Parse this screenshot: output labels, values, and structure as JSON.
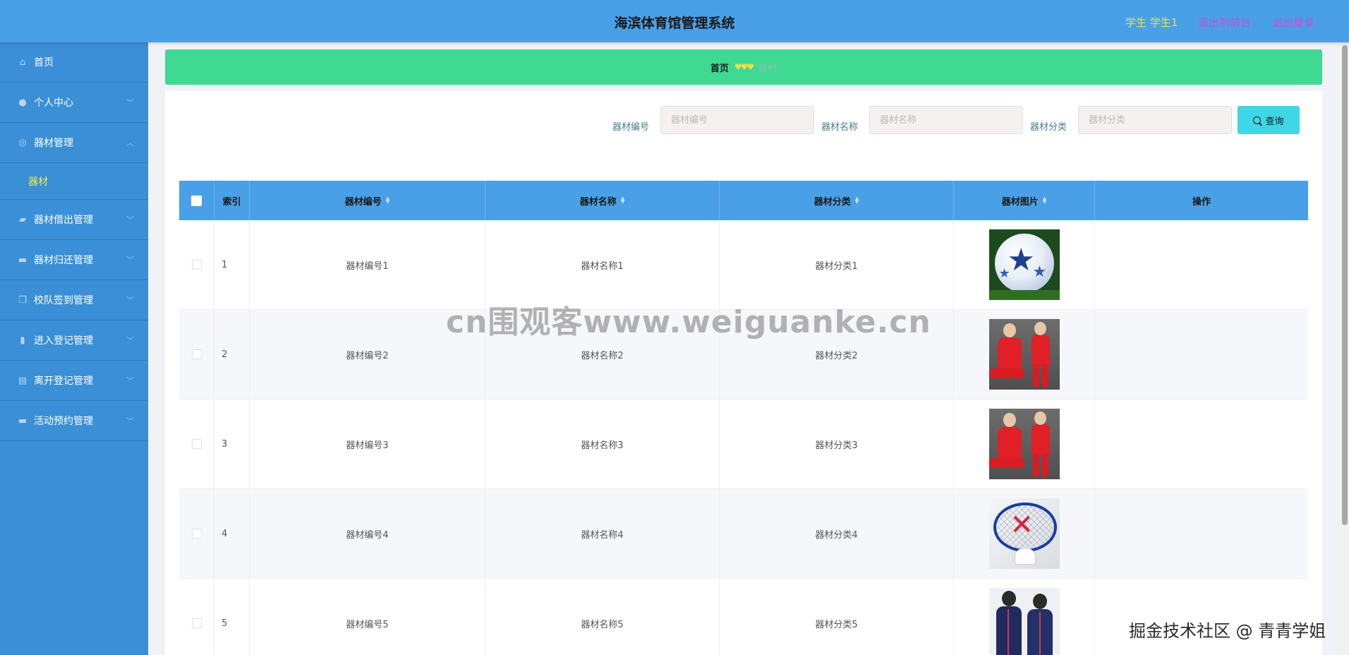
{
  "header": {
    "title": "海滨体育馆管理系统",
    "user": "学生 学生1",
    "to_frontend": "退出到前台",
    "logout": "退出登录"
  },
  "sidebar": {
    "items": [
      {
        "label": "首页",
        "icon": "home-icon"
      },
      {
        "label": "个人中心",
        "icon": "user-icon"
      },
      {
        "label": "器材管理",
        "icon": "compass-icon"
      },
      {
        "label": "器材",
        "icon": ""
      },
      {
        "label": "器材借出管理",
        "icon": "thumbs-up-icon"
      },
      {
        "label": "器材归还管理",
        "icon": "monitor-icon"
      },
      {
        "label": "校队签到管理",
        "icon": "copy-icon"
      },
      {
        "label": "进入登记管理",
        "icon": "microphone-icon"
      },
      {
        "label": "离开登记管理",
        "icon": "clipboard-icon"
      },
      {
        "label": "活动预约管理",
        "icon": "chat-icon"
      }
    ]
  },
  "breadcrumb": {
    "home": "首页",
    "hearts": "♥♥♥",
    "current": "器材"
  },
  "search": {
    "field1_label": "器材编号",
    "field1_placeholder": "器材编号",
    "field2_label": "器材名称",
    "field2_placeholder": "器材名称",
    "field3_label": "器材分类",
    "field3_placeholder": "器材分类",
    "button_label": "查询"
  },
  "table": {
    "headers": [
      "索引",
      "器材编号",
      "器材名称",
      "器材分类",
      "器材图片",
      "操作"
    ],
    "rows": [
      {
        "index": "1",
        "code": "器材编号1",
        "name": "器材名称1",
        "category": "器材分类1",
        "image": "soccer-ball"
      },
      {
        "index": "2",
        "code": "器材编号2",
        "name": "器材名称2",
        "category": "器材分类2",
        "image": "red-tracksuit"
      },
      {
        "index": "3",
        "code": "器材编号3",
        "name": "器材名称3",
        "category": "器材分类3",
        "image": "red-tracksuit"
      },
      {
        "index": "4",
        "code": "器材编号4",
        "name": "器材名称4",
        "category": "器材分类4",
        "image": "badminton"
      },
      {
        "index": "5",
        "code": "器材编号5",
        "name": "器材名称5",
        "category": "器材分类5",
        "image": "navy-tracksuit"
      }
    ]
  },
  "watermark": "cn围观客www.weiguanke.cn",
  "watermark2": "掘金技术社区 @ 青青学姐",
  "colors": {
    "header": "#4aa0e6",
    "sidebar": "#3b8fd6",
    "breadcrumb": "#3fd994",
    "search_button": "#3fd6e6",
    "active_submenu": "#e8f04a"
  }
}
